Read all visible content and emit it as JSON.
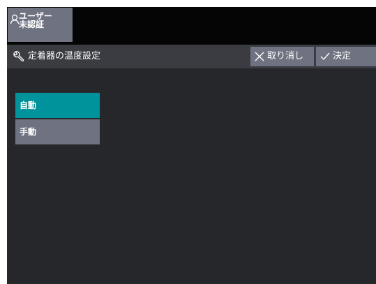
{
  "user": {
    "line1": "ユーザー",
    "line2": "未認証"
  },
  "header": {
    "title": "定着器の温度設定"
  },
  "actions": {
    "cancel_label": "取り消し",
    "ok_label": "決定"
  },
  "options": [
    {
      "label": "自動",
      "selected": true
    },
    {
      "label": "手動",
      "selected": false
    }
  ],
  "colors": {
    "background": "#26272b",
    "topbar": "#050505",
    "titlebar": "#3a3c42",
    "button": "#6f7280",
    "selected": "#00939b"
  },
  "icons": {
    "user": "user-icon",
    "wrench": "wrench-icon",
    "cancel": "close-icon",
    "ok": "check-icon"
  }
}
